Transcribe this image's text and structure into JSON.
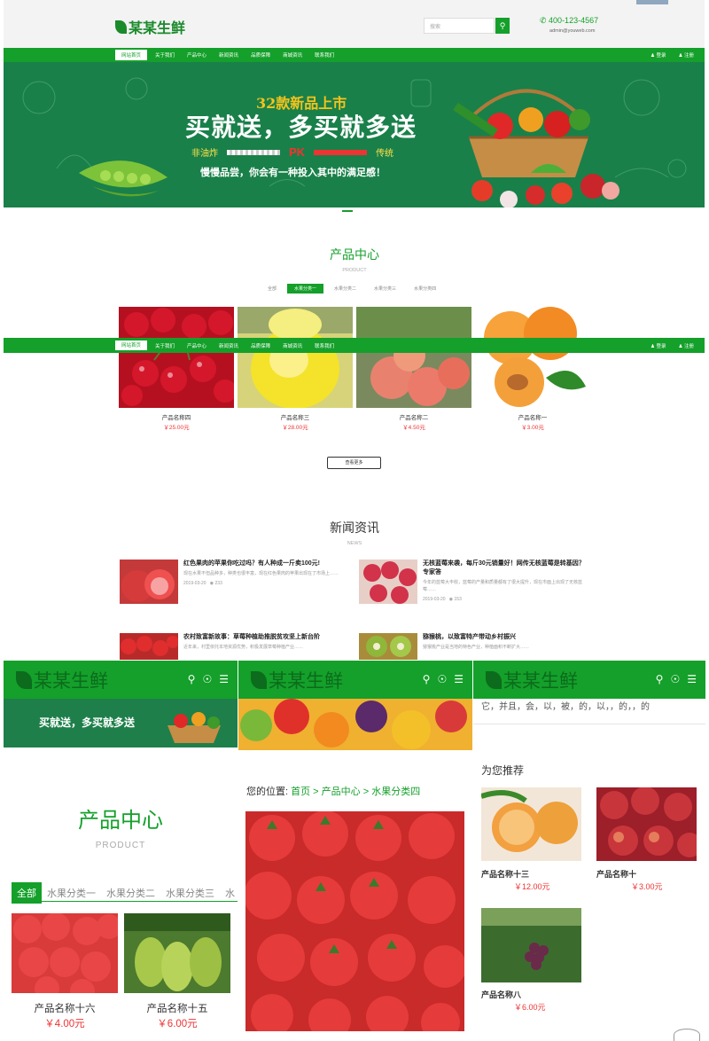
{
  "brand": "某某生鲜",
  "header": {
    "search_placeholder": "搜索",
    "phone": "400-123-4567",
    "email": "admin@youweb.com"
  },
  "nav": {
    "items": [
      "网站首页",
      "关于我们",
      "产品中心",
      "新闻资讯",
      "品质保障",
      "商城资讯",
      "联系我们"
    ],
    "login": "登录",
    "register": "注册"
  },
  "banner": {
    "subtitle": "32款新品上市",
    "title": "买就送，多买就多送",
    "pk_left": "非油炸",
    "pk": "PK",
    "pk_right": "传统",
    "slogan": "慢慢品尝，你会有一种投入其中的满足感！"
  },
  "products_section": {
    "title": "产品中心",
    "subtitle": "PRODUCT",
    "tabs": [
      "全部",
      "水果分类一",
      "水果分类二",
      "水果分类三",
      "水果分类四"
    ],
    "items": [
      {
        "name": "产品名称四",
        "price": "￥25.00元"
      },
      {
        "name": "产品名称三",
        "price": "￥28.00元"
      },
      {
        "name": "产品名称二",
        "price": "￥4.50元"
      },
      {
        "name": "产品名称一",
        "price": "￥3.00元"
      }
    ],
    "more": "查看更多"
  },
  "news_section": {
    "title": "新闻资讯",
    "subtitle": "NEWS",
    "items": [
      {
        "title": "红色果肉的苹果你吃过吗？有人种成一斤卖100元!",
        "desc": "现在水果不但品种多，种类也很丰富，现在红色果肉的苹果出现在了市场上……",
        "date": "2019-03-20",
        "views": "233"
      },
      {
        "title": "无核蓝莓来袭，每斤30元销量好！网传无核蓝莓是转基因？专家答",
        "desc": "今年的蓝莓大丰收，蓝莓的产量和质量都有了很大提升，现在市面上出现了无核蓝莓……",
        "date": "2019-03-20",
        "views": "153"
      },
      {
        "title": "农村致富新故事：草莓种植助推脱贫攻坚上新台阶",
        "desc": "近年来，村里依托本地资源优势，积极发展草莓种植产业……",
        "date": "",
        "views": ""
      },
      {
        "title": "猕猴桃，以致富特产带动乡村振兴",
        "desc": "猕猴桃产业是当地的特色产业，种植面积不断扩大……",
        "date": "",
        "views": ""
      }
    ]
  },
  "mobile1": {
    "title": "产品中心",
    "subtitle": "PRODUCT",
    "tabs": [
      "全部",
      "水果分类一",
      "水果分类二",
      "水果分类三",
      "水"
    ],
    "items": [
      {
        "name": "产品名称十六",
        "price": "￥4.00元"
      },
      {
        "name": "产品名称十五",
        "price": "￥6.00元"
      }
    ]
  },
  "mobile2": {
    "breadcrumb_label": "您的位置:",
    "breadcrumb": [
      "首页",
      "产品中心",
      "水果分类四"
    ],
    "sep": " > "
  },
  "mobile3": {
    "top_text": "它，并且，会，以，被，的，以，，的，，的",
    "recommend_title": "为您推荐",
    "items": [
      {
        "name": "产品名称十三",
        "price": "￥12.00元"
      },
      {
        "name": "产品名称十",
        "price": "￥3.00元"
      },
      {
        "name": "产品名称八",
        "price": "￥6.00元"
      }
    ]
  },
  "colors": {
    "accent": "#14a02a",
    "banner": "#19804a",
    "price": "#e33333"
  }
}
